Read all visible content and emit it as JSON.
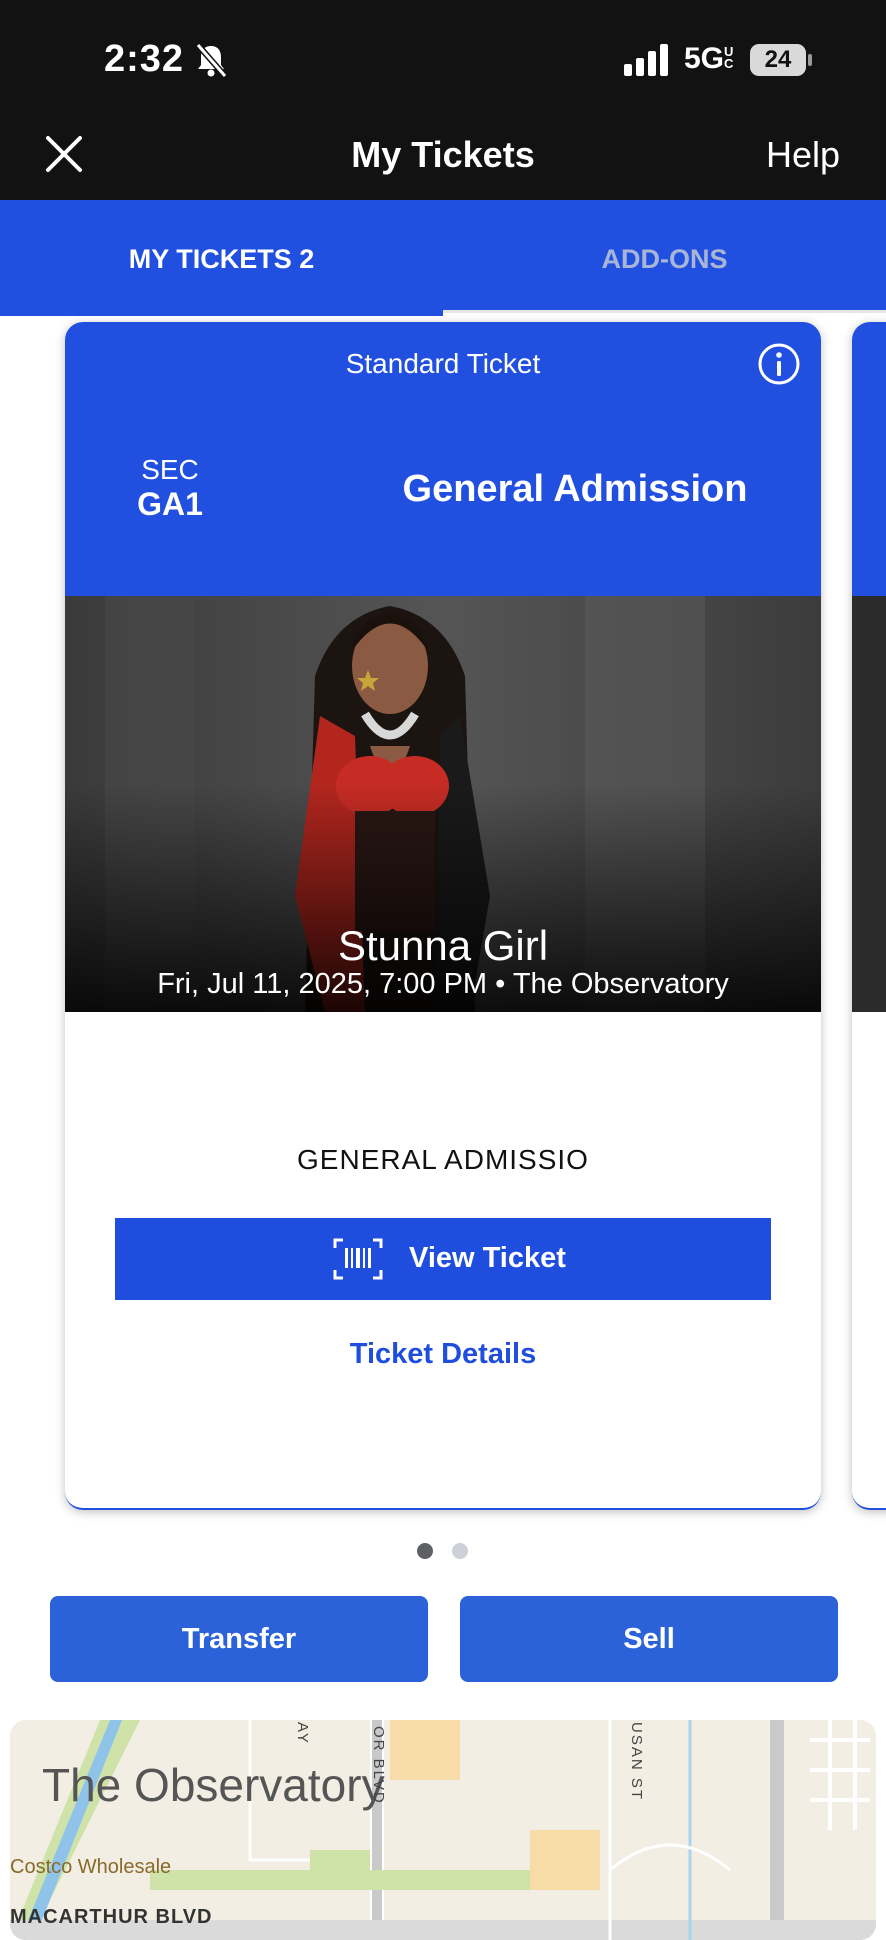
{
  "status_bar": {
    "time": "2:32",
    "network": "5G",
    "network_suffix": "UC",
    "battery": "24"
  },
  "header": {
    "title": "My Tickets",
    "help_label": "Help"
  },
  "tabs": [
    {
      "label": "MY TICKETS 2",
      "active": true
    },
    {
      "label": "ADD-ONS",
      "active": false
    }
  ],
  "ticket": {
    "type": "Standard Ticket",
    "section_label": "SEC",
    "section_value": "GA1",
    "admission": "General Admission",
    "artist": "Stunna Girl",
    "event_line": "Fri, Jul 11, 2025, 7:00 PM • The Observatory",
    "access_label": "GENERAL ADMISSIO",
    "view_label": "View Ticket",
    "details_label": "Ticket Details"
  },
  "pager": {
    "total": 2,
    "current": 1
  },
  "actions": {
    "transfer_label": "Transfer",
    "sell_label": "Sell"
  },
  "map": {
    "venue_name": "The Observatory",
    "labels": {
      "costco": "Costco Wholesale",
      "macarthur": "MACARTHUR BLVD",
      "bristol": "OR BLVD",
      "susan": "USAN ST",
      "top_left": "AY"
    }
  },
  "colors": {
    "brand_blue": "#2150e0",
    "button_blue": "#2b62d9",
    "header_bg": "#121212"
  }
}
